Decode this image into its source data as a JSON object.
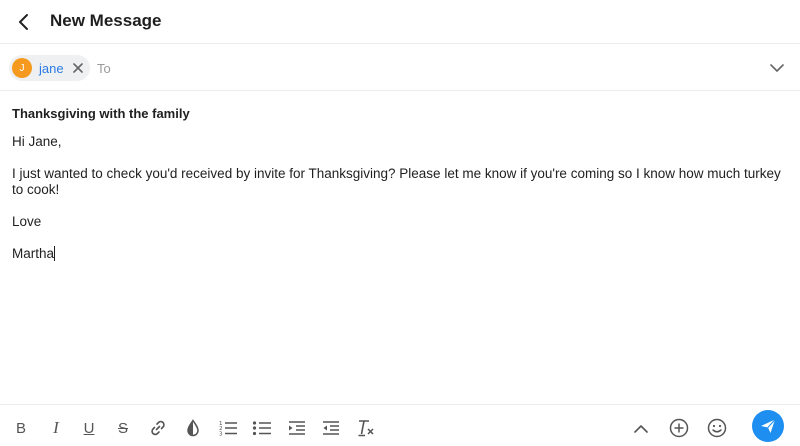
{
  "header": {
    "title": "New Message",
    "back_icon": "chevron-left-icon"
  },
  "recipients": [
    {
      "initial": "J",
      "name": "jane",
      "avatar_color": "#f59a1e"
    }
  ],
  "to_label": "To",
  "subject": "Thanksgiving with the family",
  "body": {
    "greeting": "Hi Jane,",
    "paragraph": "I just wanted to check you'd received by invite for Thanksgiving? Please let me know if you're coming so I know how much turkey to cook!",
    "signoff": "Love",
    "signature": "Martha"
  },
  "toolbar": {
    "bold": "B",
    "italic": "I",
    "underline": "U",
    "strikethrough": "S",
    "icons": [
      "link-icon",
      "color-contrast-icon",
      "numbered-list-icon",
      "bulleted-list-icon",
      "indent-icon",
      "outdent-icon",
      "clear-formatting-icon",
      "chevron-up-icon",
      "add-circle-icon",
      "emoji-icon",
      "send-icon"
    ]
  },
  "colors": {
    "accent": "#1e8ef0",
    "chip_text": "#2c7be5",
    "avatar": "#f59a1e"
  }
}
